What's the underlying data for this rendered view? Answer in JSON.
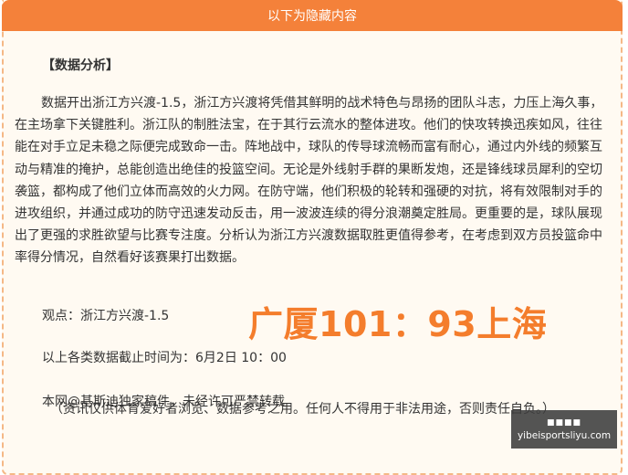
{
  "header": {
    "title": "以下为隐藏内容"
  },
  "section": {
    "title": "【数据分析】"
  },
  "analysis": {
    "paragraph": "数据开出浙江方兴渡-1.5，浙江方兴渡将凭借其鲜明的战术特色与昂扬的团队斗志，力压上海久事，在主场拿下关键胜利。浙江队的制胜法宝，在于其行云流水的整体进攻。他们的快攻转换迅疾如风，往往能在对手立足未稳之际便完成致命一击。阵地战中，球队的传导球流畅而富有耐心，通过内外线的频繁互动与精准的掩护，总能创造出绝佳的投篮空间。无论是外线射手群的果断发炮，还是锋线球员犀利的空切袭篮，都构成了他们立体而高效的火力网。在防守端，他们积极的轮转和强硬的对抗，将有效限制对手的进攻组织，并通过成功的防守迅速发动反击，用一波波连续的得分浪潮奠定胜局。更重要的是，球队展现出了更强的求胜欲望与比赛专注度。分析认为浙江方兴渡数据取胜更值得参考，在考虑到双方员投篮命中率得分情况，自然看好该赛果打出数据。",
    "viewpoint": "观点：浙江方兴渡-1.5",
    "score": "广厦101：93上海",
    "cutoff": "以上各类数据截止时间为：6月2日 10：00",
    "copyright": "本网@基斯迪独家稿件，未经许可严禁转载",
    "disclaimer": "（资讯仅供体育爱好者浏览、数据参考之用。任何人不得用于非法用途，否则责任自负。）"
  },
  "watermark": {
    "glyph": "■■■■",
    "url": "yibeisportsliyu.com"
  },
  "colors": {
    "accent": "#f4813a",
    "score": "#f47d2c",
    "border": "#f5b886",
    "background": "#fffaf2"
  }
}
